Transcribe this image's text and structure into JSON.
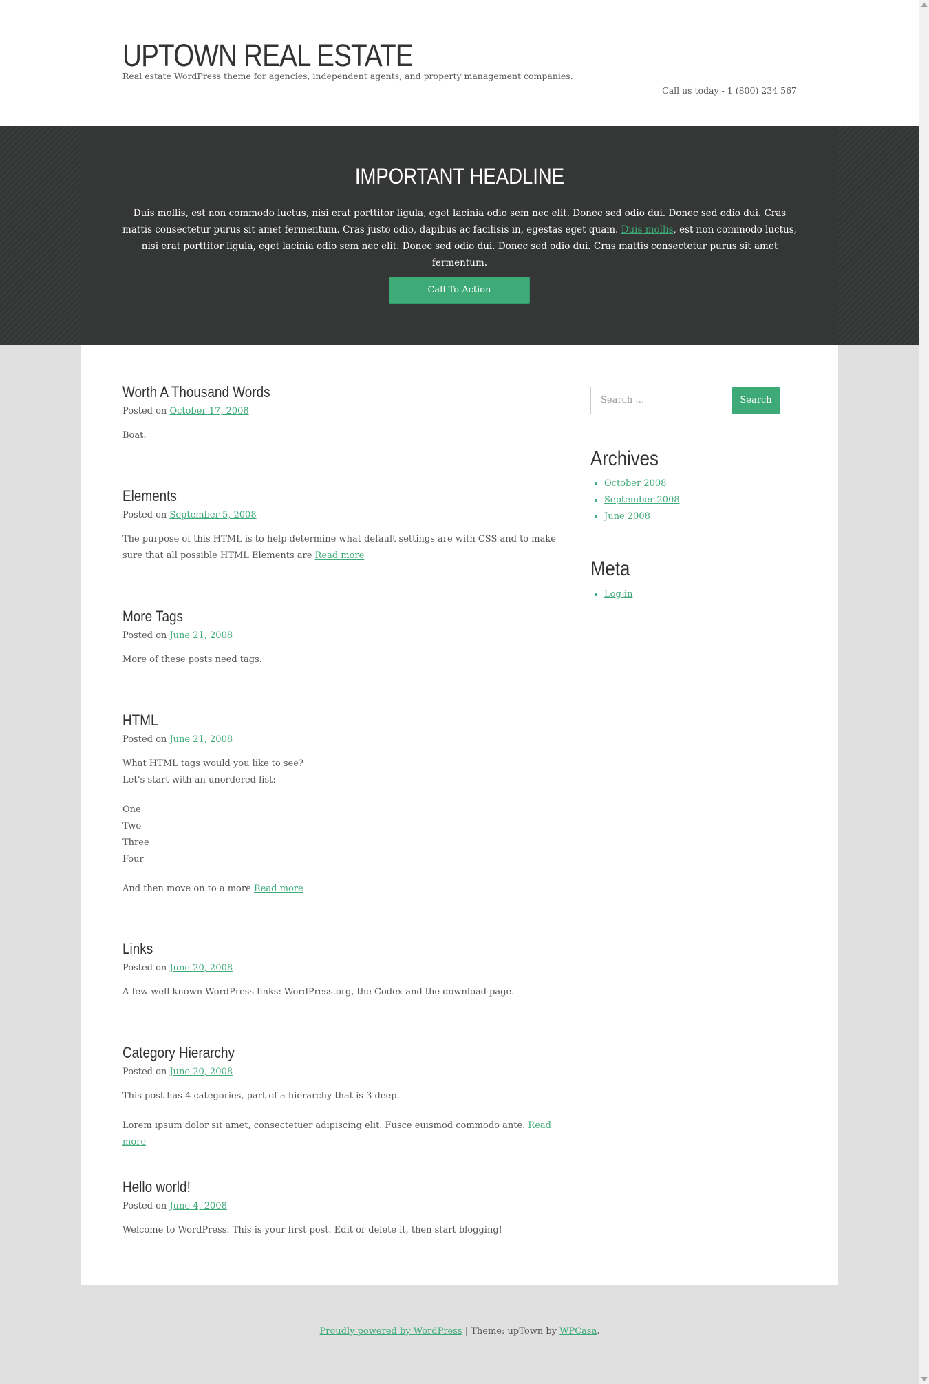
{
  "header": {
    "title": "UPTOWN REAL ESTATE",
    "tagline": "Real estate WordPress theme for agencies, independent agents, and property management companies.",
    "phone": "Call us today - 1 (800) 234 567"
  },
  "hero": {
    "headline": "IMPORTANT HEADLINE",
    "text_1": "Duis mollis, est non commodo luctus, nisi erat porttitor ligula, eget lacinia odio sem nec elit. Donec sed odio dui. Donec sed odio dui. Cras mattis consectetur purus sit amet fermentum. Cras justo odio, dapibus ac facilisis in, egestas eget quam. ",
    "link": "Duis mollis",
    "text_2": ", est non commodo luctus, nisi erat porttitor ligula, eget lacinia odio sem nec elit. Donec sed odio dui. Donec sed odio dui. Cras mattis consectetur purus sit amet fermentum.",
    "cta": "Call To Action"
  },
  "posted_on": "Posted on",
  "read_more": "Read more",
  "posts": [
    {
      "title": "Worth A Thousand Words",
      "date": "October 17, 2008",
      "p1": "Boat."
    },
    {
      "title": "Elements",
      "date": "September 5, 2008",
      "p1": "The purpose of this HTML is to help determine what default settings are with CSS and to make sure that all possible HTML Elements are"
    },
    {
      "title": "More Tags",
      "date": "June 21, 2008",
      "p1": "More of these posts need tags."
    },
    {
      "title": "HTML",
      "date": "June 21, 2008",
      "p1": "What HTML tags would you like to see?",
      "p2": "Let’s start with an unordered list:",
      "list": [
        "One",
        "Two",
        "Three",
        "Four"
      ],
      "p3": "And then move on to a more"
    },
    {
      "title": "Links",
      "date": "June 20, 2008",
      "p1": "A few well known WordPress links: WordPress.org, the Codex and the download page."
    },
    {
      "title": "Category Hierarchy",
      "date": "June 20, 2008",
      "p1": "This post has 4 categories, part of a hierarchy that is 3 deep.",
      "p2": "Lorem ipsum dolor sit amet, consectetuer adipiscing elit. Fusce euismod commodo ante."
    },
    {
      "title": "Hello world!",
      "date": "June 4, 2008",
      "p1": "Welcome to WordPress. This is your first post. Edit or delete it, then start blogging!"
    }
  ],
  "sidebar": {
    "search_placeholder": "Search …",
    "search_button": "Search",
    "archives_title": "Archives",
    "archives": [
      "October 2008",
      "September 2008",
      "June 2008"
    ],
    "meta_title": "Meta",
    "meta": [
      "Log in"
    ]
  },
  "footer": {
    "powered": "Proudly powered by WordPress",
    "theme_text": " | Theme: upTown by ",
    "theme_link": "WPCasa",
    "end": "."
  }
}
